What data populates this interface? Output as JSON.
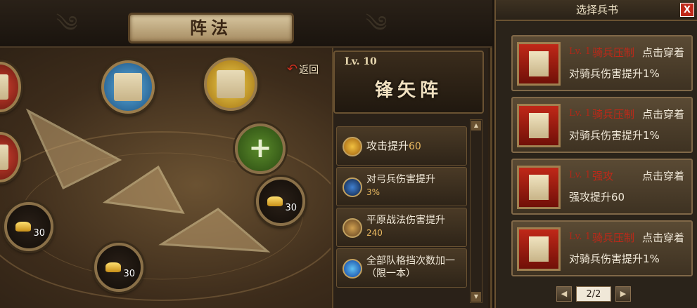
{
  "formation_panel": {
    "title": "阵法",
    "back_label": "返回",
    "slots": [
      {
        "kind": "gold",
        "value": "30"
      },
      {
        "kind": "gold",
        "value": "30"
      },
      {
        "kind": "gold",
        "value": "30"
      }
    ]
  },
  "formation_info": {
    "level": "Lv. 10",
    "name": "锋矢阵",
    "attributes": [
      {
        "name": "攻击提升",
        "value": "60",
        "icon": "attack-icon",
        "color": "#e0a020"
      },
      {
        "name": "对弓兵伤害提升",
        "value": "3%",
        "icon": "bow-icon",
        "color": "#3070c0"
      },
      {
        "name": "平原战法伤害提升",
        "value": "240",
        "icon": "plain-tactic-icon",
        "color": "#c08030"
      },
      {
        "name": "全部队格挡次数加一（限一本）",
        "value": "",
        "icon": "block-icon",
        "color": "#3090e0"
      }
    ]
  },
  "book_panel": {
    "title": "选择兵书",
    "close": "X",
    "page": "2/2",
    "books": [
      {
        "level": "Lv. 1",
        "name": "骑兵压制",
        "action": "点击穿着",
        "desc": "对骑兵伤害提升1%"
      },
      {
        "level": "Lv. 1",
        "name": "骑兵压制",
        "action": "点击穿着",
        "desc": "对骑兵伤害提升1%"
      },
      {
        "level": "Lv. 1",
        "name": "强攻",
        "action": "点击穿着",
        "desc": "强攻提升60"
      },
      {
        "level": "Lv. 1",
        "name": "骑兵压制",
        "action": "点击穿着",
        "desc": "对骑兵伤害提升1%"
      }
    ]
  }
}
